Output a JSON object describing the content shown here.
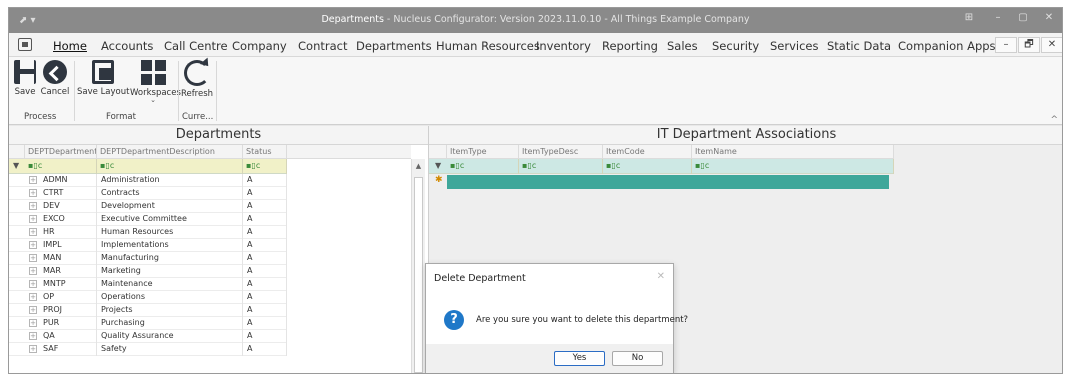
{
  "window": {
    "title_prefix": "Departments",
    "title_rest": " - Nucleus Configurator: Version 2023.11.0.10 - All Things Example Company",
    "controls": [
      "⊞",
      "–",
      "▢",
      "✕"
    ]
  },
  "menubar": {
    "items": [
      "Home",
      "Accounts",
      "Call Centre",
      "Company",
      "Contract",
      "Departments",
      "Human Resources",
      "Inventory",
      "Reporting",
      "Sales",
      "Security",
      "Services",
      "Static Data",
      "Companion Apps"
    ],
    "active": "Home",
    "mdi": [
      "–",
      "🗗",
      "✕"
    ]
  },
  "ribbon": {
    "buttons": {
      "save": "Save",
      "cancel": "Cancel",
      "save_layout": "Save Layout",
      "workspaces": "Workspaces",
      "refresh": "Refresh"
    },
    "groups": {
      "process": "Process",
      "format": "Format",
      "current": "Curre..."
    }
  },
  "departments": {
    "title": "Departments",
    "columns": [
      "DEPTDepartment",
      "DEPTDepartmentDescription",
      "Status"
    ],
    "filter_glyph": "▪▯c",
    "rows": [
      [
        "ADMN",
        "Administration",
        "A"
      ],
      [
        "CTRT",
        "Contracts",
        "A"
      ],
      [
        "DEV",
        "Development",
        "A"
      ],
      [
        "EXCO",
        "Executive Committee",
        "A"
      ],
      [
        "HR",
        "Human Resources",
        "A"
      ],
      [
        "IMPL",
        "Implementations",
        "A"
      ],
      [
        "MAN",
        "Manufacturing",
        "A"
      ],
      [
        "MAR",
        "Marketing",
        "A"
      ],
      [
        "MNTP",
        "Maintenance",
        "A"
      ],
      [
        "OP",
        "Operations",
        "A"
      ],
      [
        "PROJ",
        "Projects",
        "A"
      ],
      [
        "PUR",
        "Purchasing",
        "A"
      ],
      [
        "QA",
        "Quality Assurance",
        "A"
      ],
      [
        "SAF",
        "Safety",
        "A"
      ]
    ]
  },
  "associations": {
    "title": "IT Department Associations",
    "columns": [
      "ItemType",
      "ItemTypeDesc",
      "ItemCode",
      "ItemName"
    ],
    "filter_glyph": "▪▯c"
  },
  "dialog": {
    "title": "Delete Department",
    "message": "Are you sure you want to delete this department?",
    "yes": "Yes",
    "no": "No",
    "icon": "?"
  }
}
